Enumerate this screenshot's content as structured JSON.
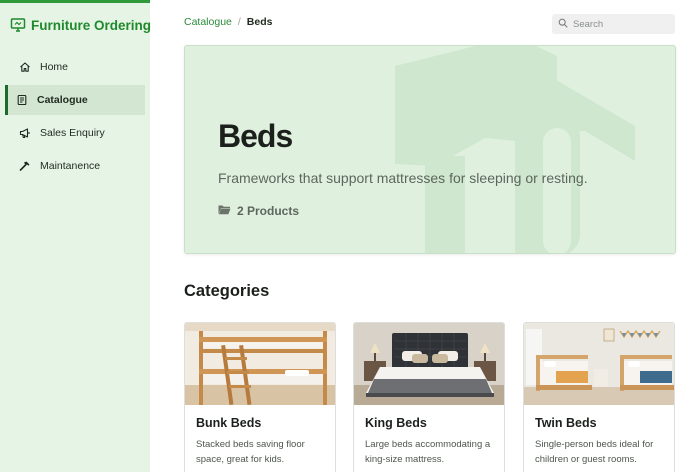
{
  "sidebar": {
    "brand_title": "Furniture Ordering",
    "brand_icon": "monitor-icon",
    "items": [
      {
        "label": "Home",
        "icon": "home-icon",
        "active": false
      },
      {
        "label": "Catalogue",
        "icon": "book-icon",
        "active": true
      },
      {
        "label": "Sales Enquiry",
        "icon": "megaphone-icon",
        "active": false
      },
      {
        "label": "Maintanence",
        "icon": "hammer-icon",
        "active": false
      }
    ]
  },
  "breadcrumb": {
    "parent": "Catalogue",
    "separator": "/",
    "current": "Beds"
  },
  "search": {
    "placeholder": "Search",
    "value": ""
  },
  "hero": {
    "title": "Beds",
    "description": "Frameworks that support mattresses for sleeping or resting.",
    "product_count": "2 Products"
  },
  "categories": {
    "heading": "Categories",
    "items": [
      {
        "name": "Bunk Beds",
        "description": "Stacked beds saving floor space, great for kids."
      },
      {
        "name": "King Beds",
        "description": "Large beds accommodating a king-size mattress."
      },
      {
        "name": "Twin Beds",
        "description": "Single-person beds ideal for children or guest rooms."
      }
    ]
  },
  "colors": {
    "accent": "#2e9a3a",
    "sidebar_bg": "#e6f4e6",
    "hero_bg": "#dff0df"
  }
}
